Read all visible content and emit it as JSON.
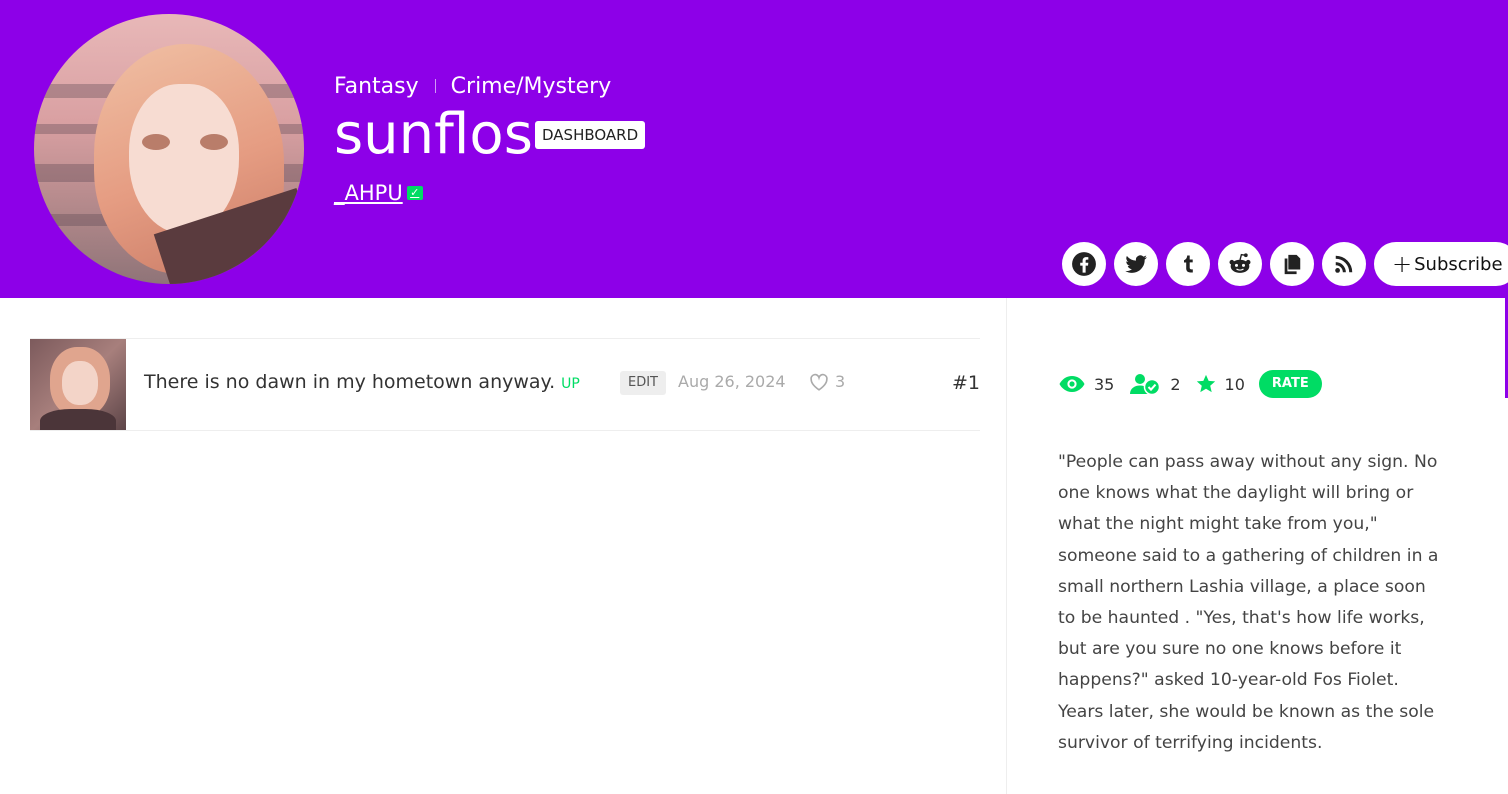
{
  "series": {
    "genres": [
      "Fantasy",
      "Crime/Mystery"
    ],
    "title": "sunflos",
    "dashboard_label": "DASHBOARD",
    "author": "_AHPU",
    "subscribe_label": "Subscribe"
  },
  "share": {
    "buttons": [
      "facebook-icon",
      "twitter-icon",
      "tumblr-icon",
      "reddit-icon",
      "copy-link-icon",
      "rss-icon"
    ]
  },
  "episodes": [
    {
      "title": "There is no dawn in my hometown anyway.",
      "badge": "UP",
      "edit_label": "EDIT",
      "date": "Aug 26, 2024",
      "likes": "3",
      "number": "#1"
    }
  ],
  "stats": {
    "views": "35",
    "subscribers": "2",
    "rating": "10",
    "rate_label": "RATE"
  },
  "synopsis": "\"People can pass away without any sign. No one knows what the daylight will bring or what the night might take from you,\" someone said to a gathering of children in a small northern Lashia village, a place soon to be haunted . \"Yes, that's how life works, but are you sure no one knows before it happens?\" asked 10-year-old Fos Fiolet. Years later, she would be known as the sole survivor of terrifying incidents.",
  "colors": {
    "brand": "#8d00e8",
    "accent": "#00dc64"
  }
}
